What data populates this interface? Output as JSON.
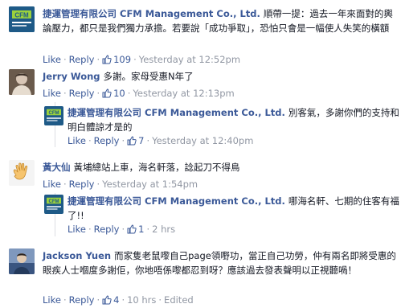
{
  "comments": [
    {
      "author": "捷運管理有限公司 CFM Management Co., Ltd.",
      "text": "順帶一提：過去一年來面對的輿論壓力，都只是我們獨力承擔。若要說「成功爭取」，恐怕只會是一幅使人失笑的橫額",
      "actions": {
        "like": "Like",
        "reply": "Reply",
        "likes": "109",
        "time": "Yesterday at 12:52pm"
      }
    },
    {
      "author": "Jerry Wong",
      "text": "多謝。家母受惠N年了",
      "actions": {
        "like": "Like",
        "reply": "Reply",
        "likes": "10",
        "time": "Yesterday at 12:13pm"
      }
    },
    {
      "author": "捷運管理有限公司 CFM Management Co., Ltd.",
      "text": "別客氣，多謝你們的支持和明白體諒才是的",
      "actions": {
        "like": "Like",
        "reply": "Reply",
        "likes": "7",
        "time": "Yesterday at 12:40pm"
      }
    },
    {
      "author": "黃大仙",
      "text": "黃埔總站上車，海名軒落，諗起刀不得鳥",
      "actions": {
        "like": "Like",
        "reply": "Reply",
        "time": "Yesterday at 1:54pm"
      }
    },
    {
      "author": "捷運管理有限公司 CFM Management Co., Ltd.",
      "text": "哪海名軒、七期的住客有福了!!",
      "actions": {
        "like": "Like",
        "reply": "Reply",
        "likes": "1",
        "time": "2 hrs"
      }
    },
    {
      "author": "Jackson Yuen",
      "text": "而家隻老鼠嚟自己page領嘢功，當正自己功勞，仲有兩名即將受惠的眼疾人士嗰度多謝佢，你地唔係嚟都忍到呀？應該過去發表聲明以正視聽喎！",
      "actions": {
        "like": "Like",
        "reply": "Reply",
        "likes": "4",
        "time": "10 hrs",
        "edited": "Edited"
      }
    }
  ],
  "colors": {
    "link": "#3b5998",
    "meta": "#9197a3",
    "text": "#141823",
    "cfm_logo_bg": "#1e5a87",
    "cfm_logo_accent": "#9bd23c"
  },
  "avatar_logo_text": "CFM"
}
